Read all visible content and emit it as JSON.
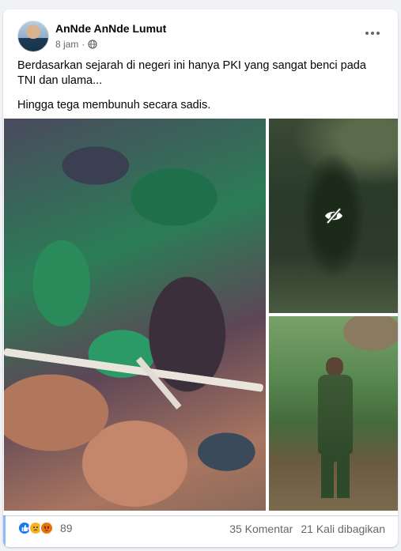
{
  "post": {
    "author": "AnNde AnNde Lumut",
    "time": "8 jam",
    "privacy_icon": "globe-icon",
    "paragraphs": [
      "Berdasarkan sejarah di negeri ini hanya PKI yang sangat benci pada TNI dan ulama...",
      "Hingga tega membunuh secara sadis."
    ]
  },
  "media": {
    "hidden_icon": "eye-slash-icon"
  },
  "footer": {
    "reactions": [
      "like-icon",
      "sad-icon",
      "angry-icon"
    ],
    "reaction_count": "89",
    "comments": "35 Komentar",
    "shares": "21 Kali dibagikan"
  },
  "colors": {
    "accent": "#1877f2",
    "secondary_text": "#65676b"
  }
}
